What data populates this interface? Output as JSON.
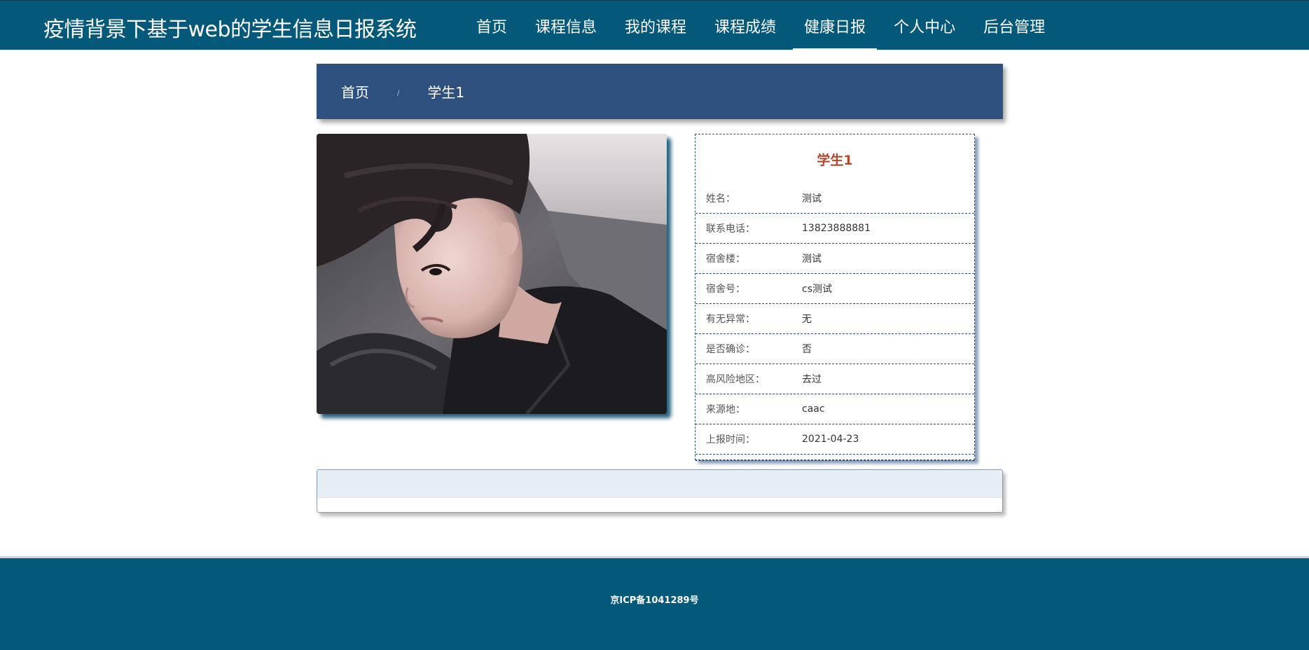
{
  "header": {
    "site_title": "疫情背景下基于web的学生信息日报系统",
    "nav": [
      {
        "label": "首页",
        "active": false
      },
      {
        "label": "课程信息",
        "active": false
      },
      {
        "label": "我的课程",
        "active": false
      },
      {
        "label": "课程成绩",
        "active": false
      },
      {
        "label": "健康日报",
        "active": true
      },
      {
        "label": "个人中心",
        "active": false
      },
      {
        "label": "后台管理",
        "active": false
      }
    ]
  },
  "breadcrumb": {
    "home": "首页",
    "separator": "/",
    "current": "学生1"
  },
  "photo": {
    "alt": "student-photo"
  },
  "info": {
    "title": "学生1",
    "rows": [
      {
        "label": "姓名：",
        "value": "测试"
      },
      {
        "label": "联系电话：",
        "value": "13823888881"
      },
      {
        "label": "宿舍楼：",
        "value": "测试"
      },
      {
        "label": "宿舍号：",
        "value": "cs测试"
      },
      {
        "label": "有无异常：",
        "value": "无"
      },
      {
        "label": "是否确诊：",
        "value": "否"
      },
      {
        "label": "高风险地区：",
        "value": "去过"
      },
      {
        "label": "来源地：",
        "value": "caac"
      },
      {
        "label": "上报时间：",
        "value": "2021-04-23"
      }
    ]
  },
  "footer": {
    "icp": "京ICP备1041289号"
  },
  "colors": {
    "header_bg": "#04587a",
    "breadcrumb_bg": "#2e507e",
    "title_accent": "#b04a2e",
    "panel_bar": "#e6edf4"
  }
}
